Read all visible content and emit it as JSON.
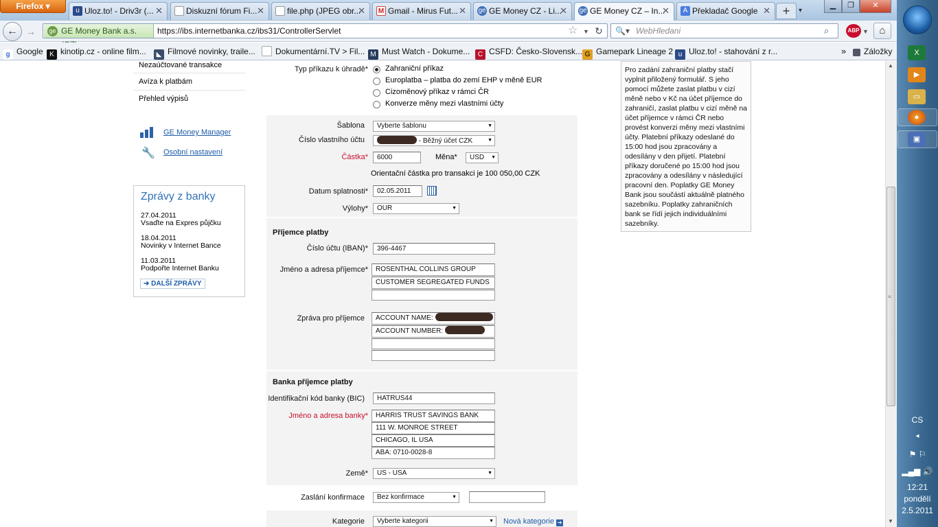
{
  "browser": {
    "menu_button": "Firefox",
    "tabs": [
      {
        "title": "Uloz.to! - Driv3r (..."
      },
      {
        "title": "Diskuzní fórum Fi..."
      },
      {
        "title": "file.php (JPEG obr..."
      },
      {
        "title": "Gmail - Mirus Fut..."
      },
      {
        "title": "GE Money CZ - Li..."
      },
      {
        "title": "GE Money CZ – In..."
      },
      {
        "title": "Překladač Google"
      }
    ],
    "identity": "GE Money Bank a.s. (CZ)",
    "url": "https://ibs.internetbanka.cz/ibs31/ControllerServlet",
    "search_placeholder": "WebHledani",
    "abp": "ABP",
    "bookmarks": [
      {
        "label": "Google"
      },
      {
        "label": "kinotip.cz - online film..."
      },
      {
        "label": "Filmové novinky, traile..."
      },
      {
        "label": "Dokumentární.TV > Fil..."
      },
      {
        "label": "Must Watch - Dokume..."
      },
      {
        "label": "CSFD: Česko-Slovensk..."
      },
      {
        "label": "Gamepark Lineage 2"
      },
      {
        "label": "Uloz.to! - stahování z r..."
      }
    ],
    "bookmarks_overflow": "»",
    "bookmarks_menu": "Záložky"
  },
  "sidebar": {
    "links": [
      "Nezaúčtované transakce",
      "Avíza k platbám",
      "Přehled výpisů"
    ],
    "tools": [
      {
        "label": "GE Money Manager"
      },
      {
        "label": "Osobní nastavení"
      }
    ],
    "news": {
      "title": "Zprávy z banky",
      "items": [
        {
          "date": "27.04.2011",
          "text": "Vsaďte na Expres půjčku"
        },
        {
          "date": "18.04.2011",
          "text": "Novinky v Internet Bance"
        },
        {
          "date": "11.03.2011",
          "text": "Podpořte Internet Banku"
        }
      ],
      "more": "DALŠÍ ZPRÁVY"
    }
  },
  "form": {
    "payment_type": {
      "label": "Typ příkazu k úhradě*",
      "options": [
        "Zahraniční příkaz",
        "Europlatba – platba do zemí EHP v měně EUR",
        "Cizoměnový příkaz v rámci ČR",
        "Konverze měny mezi vlastními účty"
      ],
      "selected_index": 0
    },
    "template": {
      "label": "Šablona",
      "value": "Vyberte šablonu"
    },
    "own_account": {
      "label": "Číslo vlastního účtu",
      "value": "- Běžný účet CZK"
    },
    "amount": {
      "label": "Částka*",
      "value": "6000"
    },
    "currency": {
      "label": "Měna*",
      "value": "USD"
    },
    "orientation_note": "Orientační částka pro transakci je 100 050,00 CZK",
    "due_date": {
      "label": "Datum splatnosti*",
      "value": "02.05.2011"
    },
    "fees": {
      "label": "Výlohy*",
      "value": "OUR"
    },
    "recipient": {
      "title": "Příjemce platby",
      "iban_label": "Číslo účtu (IBAN)*",
      "iban_value": "396-4467",
      "name_label": "Jméno a adresa příjemce*",
      "name_lines": [
        "ROSENTHAL COLLINS GROUP",
        "CUSTOMER SEGREGATED FUNDS",
        ""
      ],
      "message_label": "Zpráva pro příjemce",
      "message_lines": [
        "ACCOUNT NAME:",
        "ACCOUNT NUMBER:",
        "",
        ""
      ]
    },
    "bank": {
      "title": "Banka příjemce platby",
      "bic_label": "Identifikační kód banky (BIC)",
      "bic_value": "HATRUS44",
      "name_label": "Jméno a adresa banky*",
      "name_lines": [
        "HARRIS TRUST SAVINGS BANK",
        "111 W. MONROE STREET",
        "CHICAGO, IL USA",
        "ABA: 0710-0028-8"
      ],
      "country_label": "Země*",
      "country_value": "US - USA"
    },
    "confirmation": {
      "label": "Zaslání konfirmace",
      "value": "Bez konfirmace",
      "extra": ""
    },
    "category": {
      "label": "Kategorie",
      "value": "Vyberte kategorii",
      "new_link": "Nová kategorie"
    }
  },
  "help_text": "Pro zadání zahraniční platby stačí vyplnit přiložený formulář. S jeho pomocí můžete zaslat platbu v cizí měně nebo v Kč na účet příjemce do zahraničí, zaslat platbu v cizí měně na účet příjemce v rámci ČR nebo provést konverzi měny mezi vlastními účty. Platební příkazy odeslané do 15:00 hod jsou zpracovány a odesílány v den přijetí. Platební příkazy doručené po 15:00 hod jsou zpracovány a odesílány v následující pracovní den. Poplatky GE Money Bank jsou součástí aktuálně platného sazebníku. Poplatky zahraničních bank se řídí jejich individuálními sazebníky.",
  "taskbar": {
    "lang": "CS",
    "time": "12:21",
    "day": "pondělí",
    "date": "2.5.2011"
  }
}
